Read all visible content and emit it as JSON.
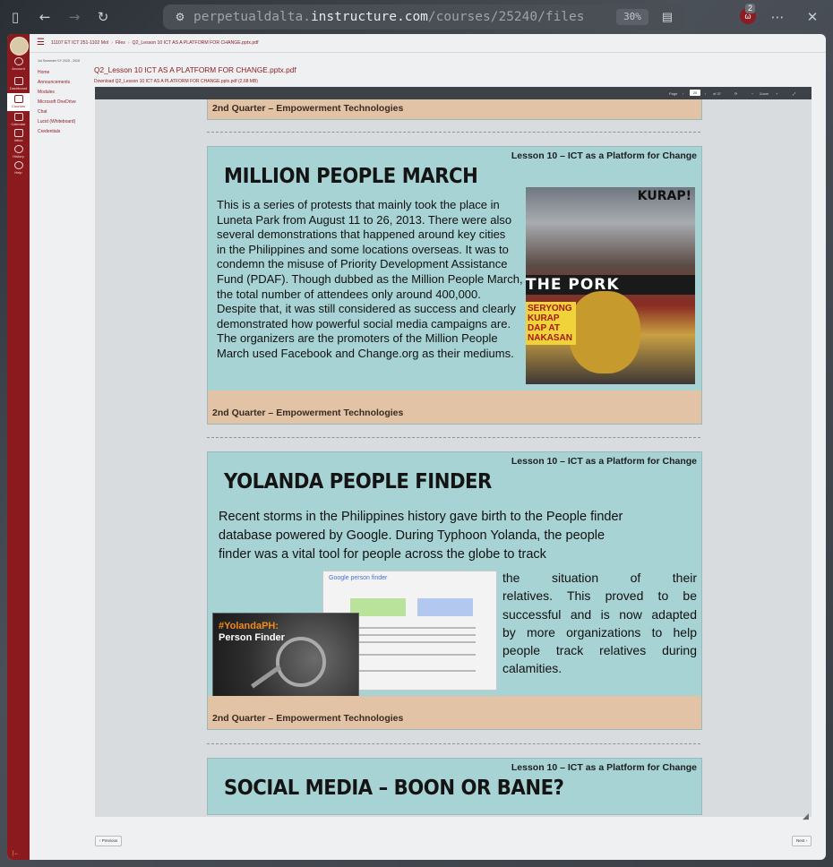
{
  "browser": {
    "url_prefix": "perpetualdalta.",
    "url_host": "instructure.com",
    "url_path": "/courses/25240/files",
    "zoom": "30%",
    "ext_badge": "2",
    "icons": {
      "sidebar": "sidebar-toggle-icon",
      "back": "back-arrow-icon",
      "forward": "forward-arrow-icon",
      "reload": "reload-icon",
      "site": "site-info-icon",
      "reader": "reader-mode-icon",
      "menu": "more-icon",
      "close": "close-icon"
    }
  },
  "canvas": {
    "accent": "#8b1a1f",
    "rail_items": [
      {
        "label": "Account"
      },
      {
        "label": "Dashboard"
      },
      {
        "label": "Courses"
      },
      {
        "label": "Calendar"
      },
      {
        "label": "Inbox"
      },
      {
        "label": "History"
      },
      {
        "label": "Help"
      }
    ],
    "breadcrumbs": [
      "11107 ET ICT 251-1102 Mol",
      "Files",
      "Q2_Lesson 10 ICT AS A PLATFORM FOR CHANGE.pptx.pdf"
    ],
    "course_term": "1st Semester SY 2025 - 2026",
    "course_nav": [
      "Home",
      "Announcements",
      "Modules",
      "Microsoft OneDrive",
      "Chat",
      "Lucid (Whiteboard)",
      "Credentials"
    ],
    "file_title": "Q2_Lesson 10 ICT AS A PLATFORM FOR CHANGE.pptx.pdf",
    "download_link": "Download Q2_Lesson 10 ICT AS A PLATFORM FOR CHANGE.pptx.pdf (2.68 MB)",
    "prev_button": "‹ Previous",
    "next_button": "Next ›"
  },
  "viewer": {
    "page_label": "Page",
    "page_current": "20",
    "page_total": "of 37",
    "zoom_label": "Zoom"
  },
  "slides": {
    "footer": "2nd Quarter – Empowerment Technologies",
    "header": "Lesson 10 – ICT as a Platform for Change",
    "million": {
      "title": "MILLION PEOPLE MARCH",
      "lines": [
        "This is a series of protests that mainly took the place in",
        "Luneta Park from August 11 to 26, 2013. There were also",
        "several demonstrations that happened around key cities",
        "in the Philippines and some locations overseas. It was to",
        "condemn the misuse of Priority Development Assistance",
        "Fund (PDAF). Though dubbed as the Million People March,",
        "the total number of attendees only around 400,000.",
        "Despite that, it was still considered as success and clearly",
        "demonstrated how powerful social media campaigns are.",
        "The organizers are the promoters of the Million People",
        "March used Facebook and Change.org as their mediums."
      ],
      "photo_sign_top": "KURAP!",
      "photo_banner": "THE PORK",
      "photo_sign_left": "SERYONG KURAP DAP AT NAKASAN"
    },
    "yolanda": {
      "title": "YOLANDA PEOPLE FINDER",
      "lines_top": [
        "Recent storms in the Philippines history gave birth to the People finder",
        "database powered by Google. During Typhoon Yolanda, the people",
        "finder was a vital tool for people across the globe to track"
      ],
      "lines_right": [
        "the situation of their",
        "relatives. This proved to be",
        "successful and is now adapted",
        "by more organizations to help",
        "people track relatives during",
        "calamities."
      ],
      "google_label": "Google person finder",
      "image_tag": "#YolandaPH:",
      "image_title": "Person Finder"
    },
    "social": {
      "title": "SOCIAL MEDIA – BOON OR BANE?"
    }
  }
}
